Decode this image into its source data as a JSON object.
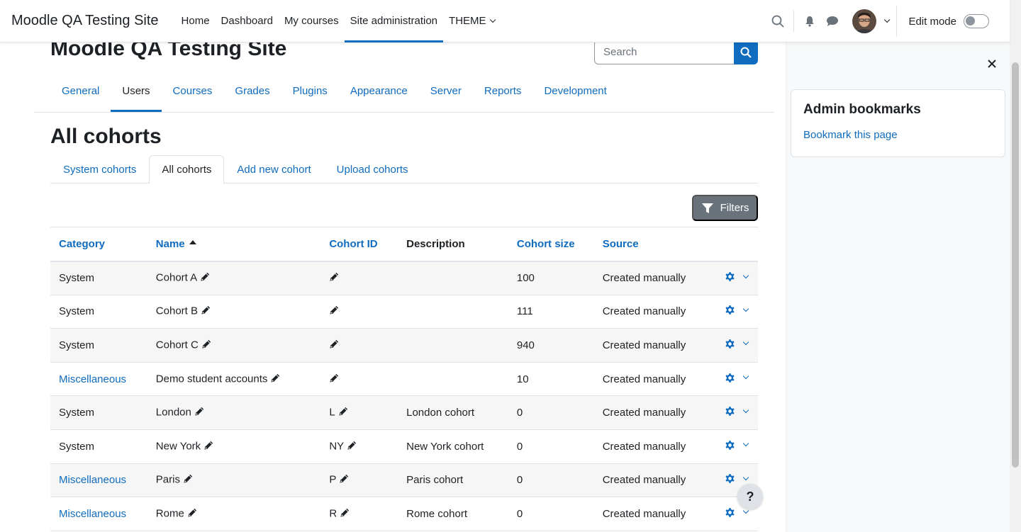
{
  "navbar": {
    "brand": "Moodle QA Testing Site",
    "items": [
      {
        "label": "Home"
      },
      {
        "label": "Dashboard"
      },
      {
        "label": "My courses"
      },
      {
        "label": "Site administration",
        "active": true
      },
      {
        "label": "THEME",
        "dropdown": true
      }
    ],
    "edit_mode_label": "Edit mode",
    "edit_mode_on": false,
    "icons": [
      "search-icon",
      "bell-icon",
      "chat-icon",
      "user-avatar",
      "chevron-down-icon"
    ]
  },
  "header": {
    "title": "Moodle QA Testing Site",
    "search_placeholder": "Search"
  },
  "secondary_nav": {
    "items": [
      {
        "label": "General"
      },
      {
        "label": "Users",
        "active": true
      },
      {
        "label": "Courses"
      },
      {
        "label": "Grades"
      },
      {
        "label": "Plugins"
      },
      {
        "label": "Appearance"
      },
      {
        "label": "Server"
      },
      {
        "label": "Reports"
      },
      {
        "label": "Development"
      }
    ]
  },
  "page": {
    "heading": "All cohorts",
    "tabs": [
      {
        "label": "System cohorts"
      },
      {
        "label": "All cohorts",
        "active": true
      },
      {
        "label": "Add new cohort"
      },
      {
        "label": "Upload cohorts"
      }
    ],
    "filters_label": "Filters"
  },
  "table": {
    "headers": {
      "category": "Category",
      "name": "Name",
      "cohort_id": "Cohort ID",
      "description": "Description",
      "cohort_size": "Cohort size",
      "source": "Source"
    },
    "rows": [
      {
        "category": "System",
        "category_link": false,
        "name": "Cohort A",
        "cohort_id": "",
        "description": "",
        "size": "100",
        "source": "Created manually"
      },
      {
        "category": "System",
        "category_link": false,
        "name": "Cohort B",
        "cohort_id": "",
        "description": "",
        "size": "111",
        "source": "Created manually"
      },
      {
        "category": "System",
        "category_link": false,
        "name": "Cohort C",
        "cohort_id": "",
        "description": "",
        "size": "940",
        "source": "Created manually"
      },
      {
        "category": "Miscellaneous",
        "category_link": true,
        "name": "Demo student accounts",
        "cohort_id": "",
        "description": "",
        "size": "10",
        "source": "Created manually"
      },
      {
        "category": "System",
        "category_link": false,
        "name": "London",
        "cohort_id": "L",
        "description": "London cohort",
        "size": "0",
        "source": "Created manually"
      },
      {
        "category": "System",
        "category_link": false,
        "name": "New York",
        "cohort_id": "NY",
        "description": "New York cohort",
        "size": "0",
        "source": "Created manually"
      },
      {
        "category": "Miscellaneous",
        "category_link": true,
        "name": "Paris",
        "cohort_id": "P",
        "description": "Paris cohort",
        "size": "0",
        "source": "Created manually"
      },
      {
        "category": "Miscellaneous",
        "category_link": true,
        "name": "Rome",
        "cohort_id": "R",
        "description": "Rome cohort",
        "size": "0",
        "source": "Created manually"
      }
    ]
  },
  "drawer": {
    "block_title": "Admin bookmarks",
    "block_link": "Bookmark this page"
  },
  "help_label": "?",
  "colors": {
    "accent": "#0f6cbf",
    "text": "#1d2125",
    "filters_bg": "#6a737b",
    "drawer_bg": "#f8f9fa"
  }
}
